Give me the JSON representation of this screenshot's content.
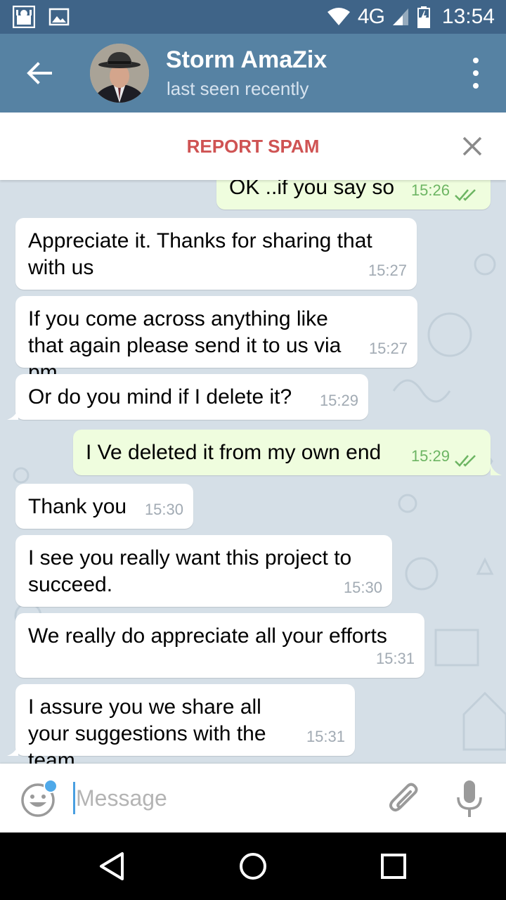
{
  "status_bar": {
    "network": "4G",
    "time": "13:54",
    "icons": [
      "app-notification-icon",
      "image-icon",
      "wifi-icon",
      "signal-icon",
      "battery-icon"
    ]
  },
  "header": {
    "contact_name": "Storm AmaZix",
    "contact_status": "last seen recently",
    "icons": [
      "back-arrow-icon",
      "more-vert-icon"
    ]
  },
  "spam_bar": {
    "label": "REPORT SPAM"
  },
  "messages": [
    {
      "direction": "out",
      "text": "OK ..if you say so",
      "time": "15:26",
      "read": true
    },
    {
      "direction": "in",
      "text": "Appreciate it. Thanks for sharing that with us",
      "time": "15:27"
    },
    {
      "direction": "in",
      "text": "If you come across anything like that again please send it to us via pm",
      "time": "15:27"
    },
    {
      "direction": "in",
      "text": "Or do you mind if I delete it?",
      "time": "15:29"
    },
    {
      "direction": "out",
      "text": "I Ve deleted it from my own end",
      "time": "15:29",
      "read": true
    },
    {
      "direction": "in",
      "text": "Thank you",
      "time": "15:30"
    },
    {
      "direction": "in",
      "text": "I see you really want this project to succeed.",
      "time": "15:30"
    },
    {
      "direction": "in",
      "text": "We really do appreciate all your efforts",
      "time": "15:31"
    },
    {
      "direction": "in",
      "text": "I assure you we share all your suggestions with the team",
      "time": "15:31"
    }
  ],
  "composer": {
    "placeholder": "Message",
    "value": ""
  },
  "colors": {
    "status_bar": "#3f6488",
    "header": "#5682a3",
    "spam_text": "#cf5353",
    "chat_bg": "#d5dfe7",
    "bubble_in": "#ffffff",
    "bubble_out": "#effdde",
    "out_time": "#6db563"
  }
}
